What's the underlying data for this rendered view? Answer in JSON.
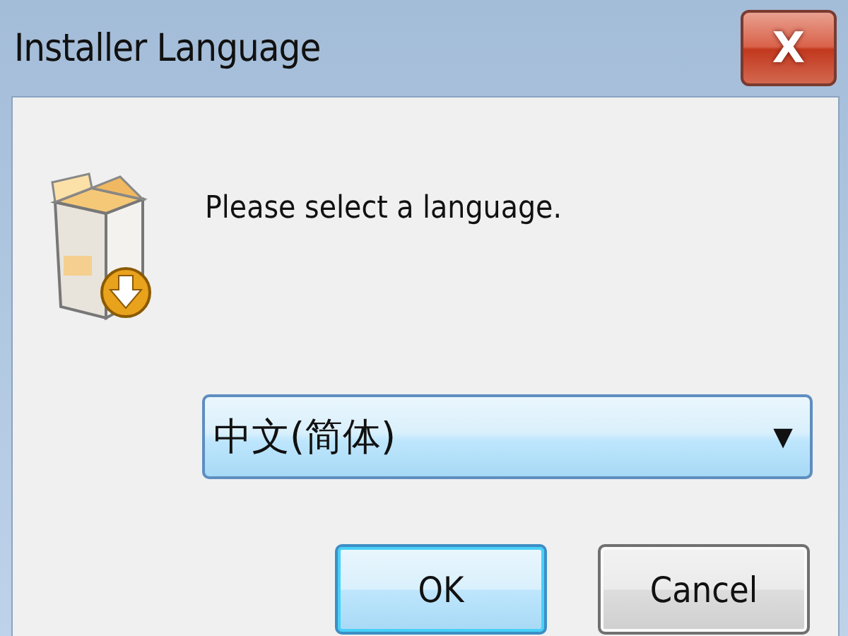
{
  "window": {
    "title": "Installer Language",
    "close": "X"
  },
  "prompt": "Please select a language.",
  "language_select": {
    "value": "中文(简体)",
    "arrow": "▼"
  },
  "buttons": [
    {
      "label": "OK",
      "default": true
    },
    {
      "label": "Cancel",
      "default": false
    }
  ]
}
